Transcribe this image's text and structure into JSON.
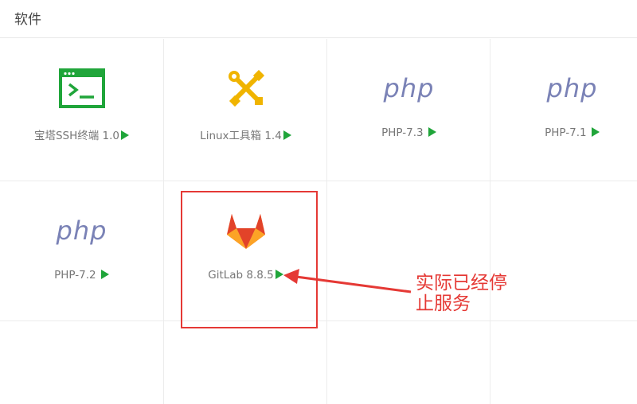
{
  "header": {
    "title": "软件"
  },
  "software": [
    {
      "name": "宝塔SSH终端 1.0",
      "icon": "terminal-icon"
    },
    {
      "name": "Linux工具箱 1.4",
      "icon": "tools-icon"
    },
    {
      "name": "PHP-7.3",
      "icon": "php-logo",
      "logo_text": "php"
    },
    {
      "name": "PHP-7.1",
      "icon": "php-logo",
      "logo_text": "php"
    },
    {
      "name": "PHP-7.2",
      "icon": "php-logo",
      "logo_text": "php"
    },
    {
      "name": "GitLab 8.8.5",
      "icon": "gitlab-icon"
    }
  ],
  "annotation": {
    "line1": "实际已经停",
    "line2": "止服务"
  },
  "colors": {
    "play": "#20a53a",
    "terminal": "#20a53a",
    "tools": "#f0b400",
    "php": "#7a82b6",
    "annotation": "#e53935"
  }
}
